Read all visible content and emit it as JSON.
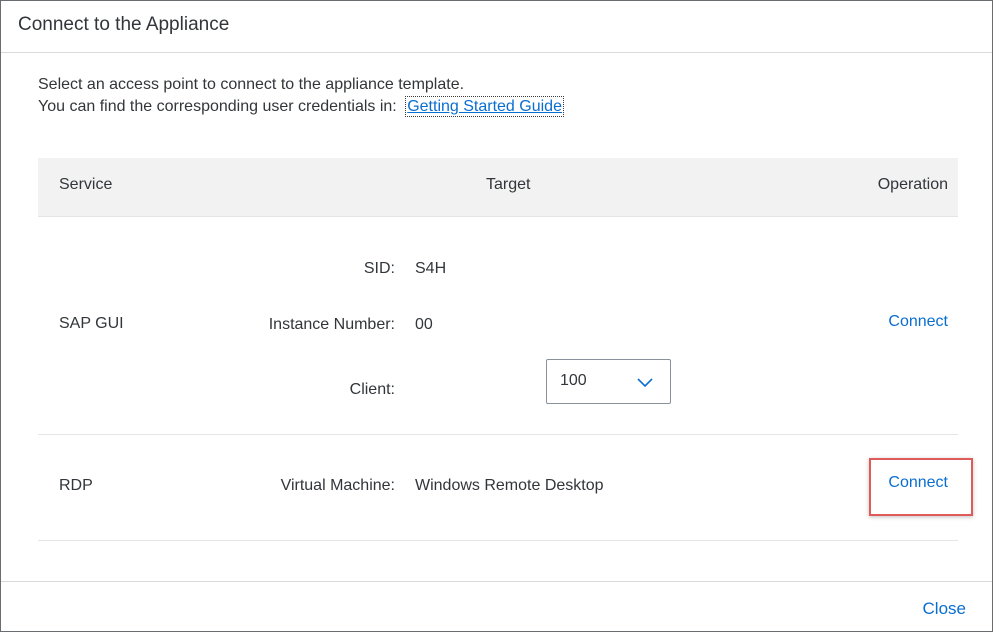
{
  "dialog": {
    "title": "Connect to the Appliance",
    "intro_line1": "Select an access point to connect to the appliance template.",
    "intro_line2": "You can find the corresponding user credentials in:",
    "guide_link": "Getting Started Guide",
    "close_label": "Close"
  },
  "table": {
    "headers": {
      "service": "Service",
      "target": "Target",
      "operation": "Operation"
    },
    "rows": [
      {
        "service": "SAP GUI",
        "fields": [
          {
            "label": "SID:",
            "value": "S4H"
          },
          {
            "label": "Instance Number:",
            "value": "00"
          },
          {
            "label": "Client:",
            "value": "100"
          }
        ],
        "operation": "Connect"
      },
      {
        "service": "RDP",
        "fields": [
          {
            "label": "Virtual Machine:",
            "value": "Windows Remote Desktop"
          }
        ],
        "operation": "Connect"
      }
    ]
  },
  "icons": {
    "select_arrow": "chevron-down-icon"
  },
  "colors": {
    "link": "#0a6ed1",
    "highlight": "#e05a5a",
    "header_bg": "#f2f2f2"
  }
}
